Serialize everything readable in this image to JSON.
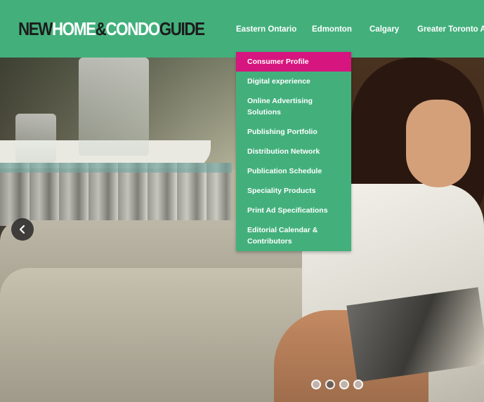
{
  "brand": {
    "logo_parts": [
      "NEW",
      "HOME",
      "&",
      "CONDO",
      "GUIDE"
    ]
  },
  "nav": {
    "items": [
      "Eastern Ontario",
      "Edmonton",
      "Calgary",
      "Greater Toronto Are"
    ]
  },
  "dropdown": {
    "items": [
      "Consumer Profile",
      "Digital experience",
      "Online Advertising Solutions",
      "Publishing Portfolio",
      "Distribution Network",
      "Publication Schedule",
      "Speciality Products",
      "Print Ad Specifications",
      "Editorial Calendar & Contributors"
    ],
    "active_index": 0
  },
  "slider": {
    "prev_icon": "chevron-left-icon",
    "dot_count": 4,
    "active_dot": 1
  },
  "colors": {
    "header_green": "#43b07c",
    "active_pink": "#d6167e"
  }
}
